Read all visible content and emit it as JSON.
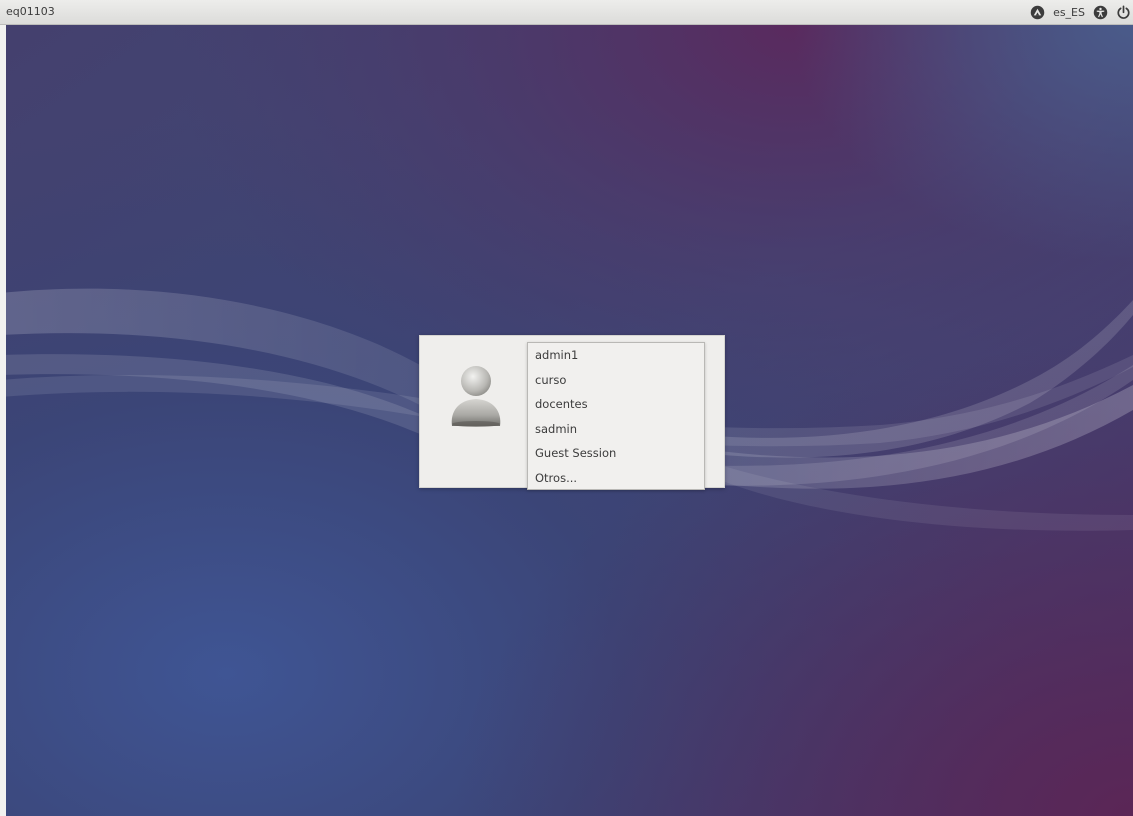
{
  "top_panel": {
    "hostname": "eq01103",
    "network_icon": "network-icon",
    "language": "es_ES",
    "accessibility_icon": "accessibility-icon",
    "power_icon": "power-icon"
  },
  "login": {
    "avatar_icon": "user-avatar-icon",
    "users": [
      {
        "label": "admin1"
      },
      {
        "label": "curso"
      },
      {
        "label": "docentes"
      },
      {
        "label": "sadmin"
      },
      {
        "label": "Guest Session"
      },
      {
        "label": "Otros..."
      }
    ]
  },
  "colors": {
    "panel": "#e6e6e4",
    "wallpaper_base": "#3d3f6e",
    "wallpaper_accent": "#5a2a5e",
    "dialog": "#efeeec"
  }
}
